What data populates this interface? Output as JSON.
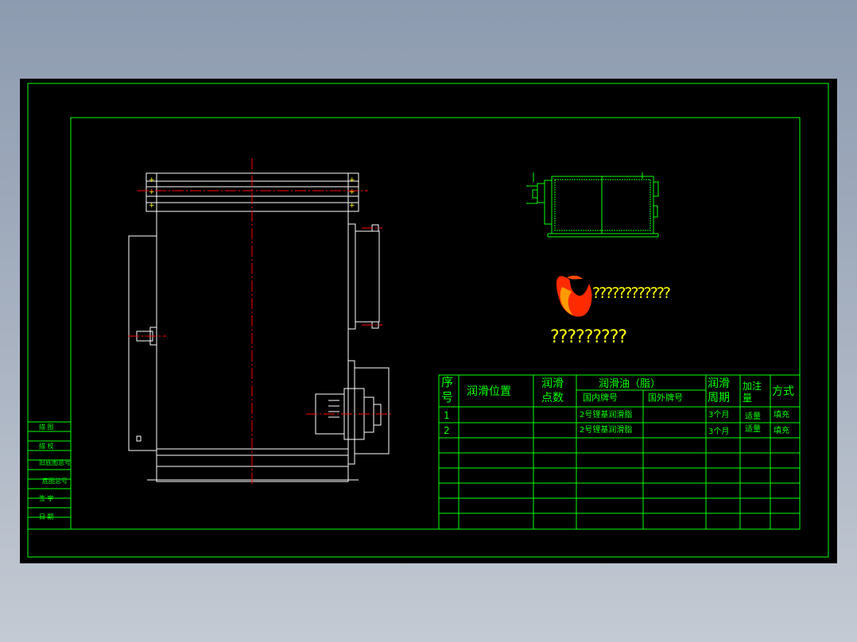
{
  "sheet": {
    "background": "#000000",
    "frame_color": "#00ff00",
    "outline_color": "#ffffff",
    "centerline_color": "#ff0000",
    "accent_color": "#ffff00"
  },
  "side_labels": [
    "描 图",
    "描 校",
    "旧底图总号",
    "底图总号",
    "签 字",
    "日 期"
  ],
  "logo": {
    "line1": "????????????",
    "line2": "?????????",
    "flame_colors": [
      "#ff2a00",
      "#ff9a00"
    ]
  },
  "lube_table": {
    "headers": {
      "seq": "序号",
      "position": "润滑位置",
      "points": "润滑点数",
      "oil": "润滑油（脂）",
      "domestic": "国内牌号",
      "foreign": "国外牌号",
      "period": "润滑周期",
      "amount": "加注量",
      "method": "方式"
    },
    "rows": [
      {
        "seq": "1",
        "position": "",
        "points": "",
        "domestic": "2号锂基润滑脂",
        "foreign": "",
        "period": "3个月",
        "amount": "适量",
        "method": "填充"
      },
      {
        "seq": "2",
        "position": "",
        "points": "",
        "domestic": "2号锂基润滑脂",
        "foreign": "",
        "period": "3个月",
        "amount": "适量",
        "method": "填充"
      }
    ],
    "empty_rows": 6
  }
}
